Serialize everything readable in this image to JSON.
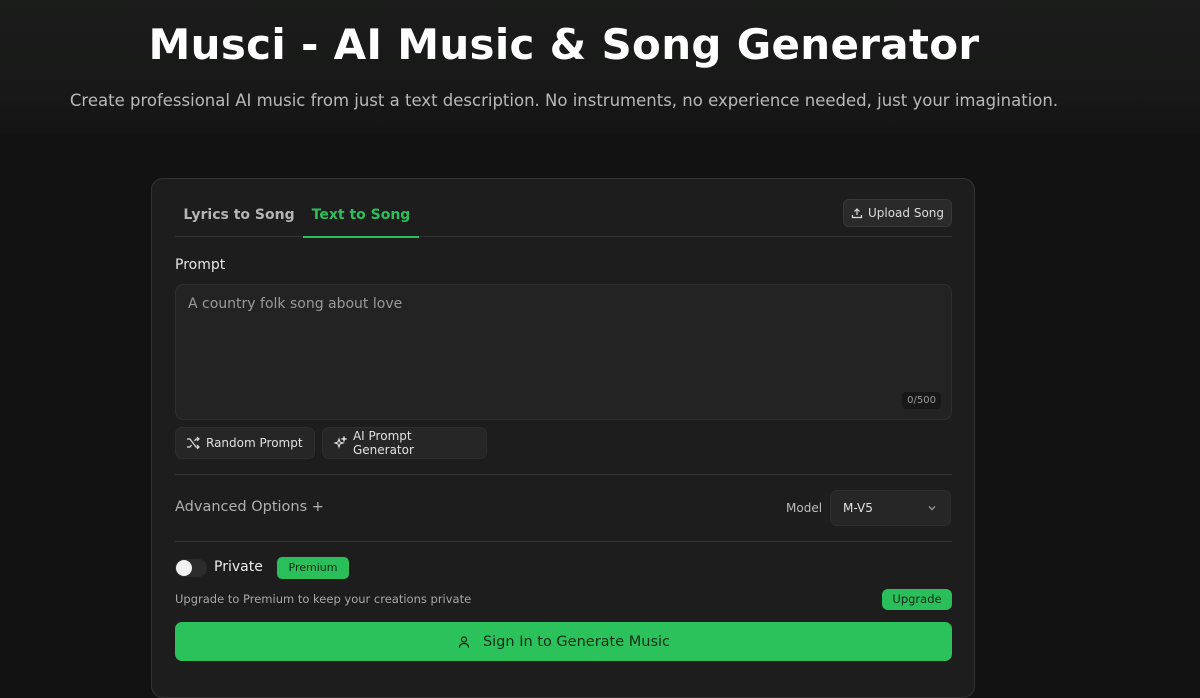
{
  "header": {
    "title": "Musci - AI Music & Song Generator",
    "subtitle": "Create professional AI music from just a text description. No instruments, no experience needed, just your imagination."
  },
  "tabs": [
    {
      "label": "Lyrics to Song",
      "active": false
    },
    {
      "label": "Text to Song",
      "active": true
    }
  ],
  "upload": {
    "label": "Upload Song",
    "icon": "upload-icon"
  },
  "prompt": {
    "label": "Prompt",
    "placeholder": "A country folk song about love",
    "value": "",
    "char_count": "0/500"
  },
  "helpers": [
    {
      "label": "Random Prompt",
      "icon": "shuffle-icon"
    },
    {
      "label": "AI Prompt Generator",
      "icon": "sparkle-icon"
    }
  ],
  "advanced": {
    "label": "Advanced Options +"
  },
  "model": {
    "label": "Model",
    "selected": "M-V5",
    "icon": "chevron-down-icon"
  },
  "privacy": {
    "label": "Private",
    "enabled": false,
    "badge": "Premium",
    "note": "Upgrade to Premium to keep your creations private",
    "upgrade_label": "Upgrade"
  },
  "submit": {
    "label": "Sign In to Generate Music",
    "icon": "user-icon"
  },
  "colors": {
    "accent": "#2bbf5c",
    "background": "#121212",
    "card": "#1d1d1d"
  }
}
